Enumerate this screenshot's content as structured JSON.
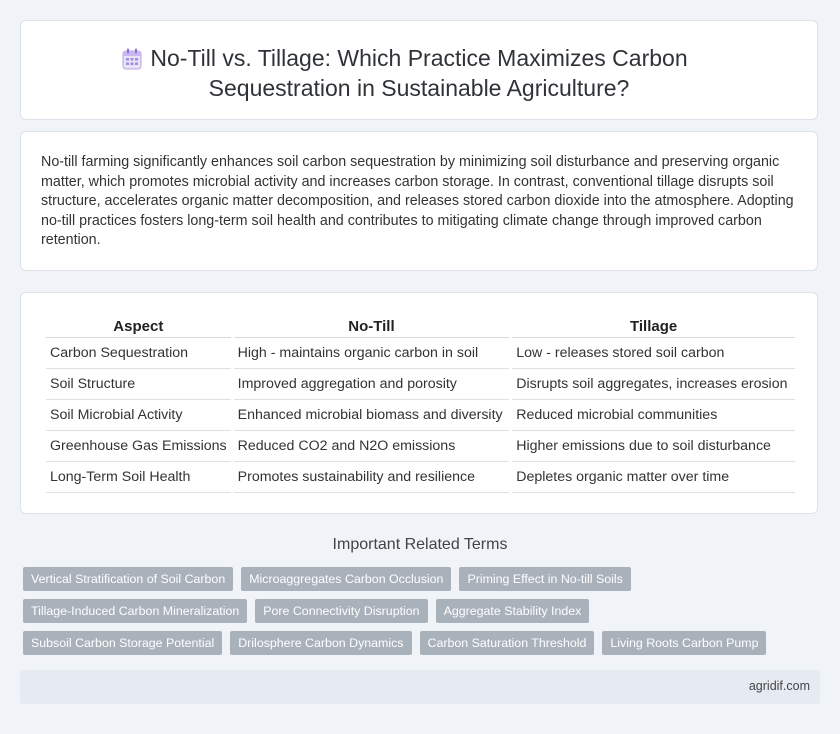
{
  "header": {
    "title": "No-Till vs. Tillage: Which Practice Maximizes Carbon Sequestration in Sustainable Agriculture?",
    "icon": "calendar-icon"
  },
  "intro": {
    "text": "No-till farming significantly enhances soil carbon sequestration by minimizing soil disturbance and preserving organic matter, which promotes microbial activity and increases carbon storage. In contrast, conventional tillage disrupts soil structure, accelerates organic matter decomposition, and releases stored carbon dioxide into the atmosphere. Adopting no-till practices fosters long-term soil health and contributes to mitigating climate change through improved carbon retention."
  },
  "table": {
    "headers": [
      "Aspect",
      "No-Till",
      "Tillage"
    ],
    "rows": [
      [
        "Carbon Sequestration",
        "High - maintains organic carbon in soil",
        "Low - releases stored soil carbon"
      ],
      [
        "Soil Structure",
        "Improved aggregation and porosity",
        "Disrupts soil aggregates, increases erosion"
      ],
      [
        "Soil Microbial Activity",
        "Enhanced microbial biomass and diversity",
        "Reduced microbial communities"
      ],
      [
        "Greenhouse Gas Emissions",
        "Reduced CO2 and N2O emissions",
        "Higher emissions due to soil disturbance"
      ],
      [
        "Long-Term Soil Health",
        "Promotes sustainability and resilience",
        "Depletes organic matter over time"
      ]
    ]
  },
  "related": {
    "title": "Important Related Terms",
    "tags": [
      "Vertical Stratification of Soil Carbon",
      "Microaggregates Carbon Occlusion",
      "Priming Effect in No-till Soils",
      "Tillage-Induced Carbon Mineralization",
      "Pore Connectivity Disruption",
      "Aggregate Stability Index",
      "Subsoil Carbon Storage Potential",
      "Drilosphere Carbon Dynamics",
      "Carbon Saturation Threshold",
      "Living Roots Carbon Pump"
    ]
  },
  "footer": {
    "site": "agridif.com"
  }
}
